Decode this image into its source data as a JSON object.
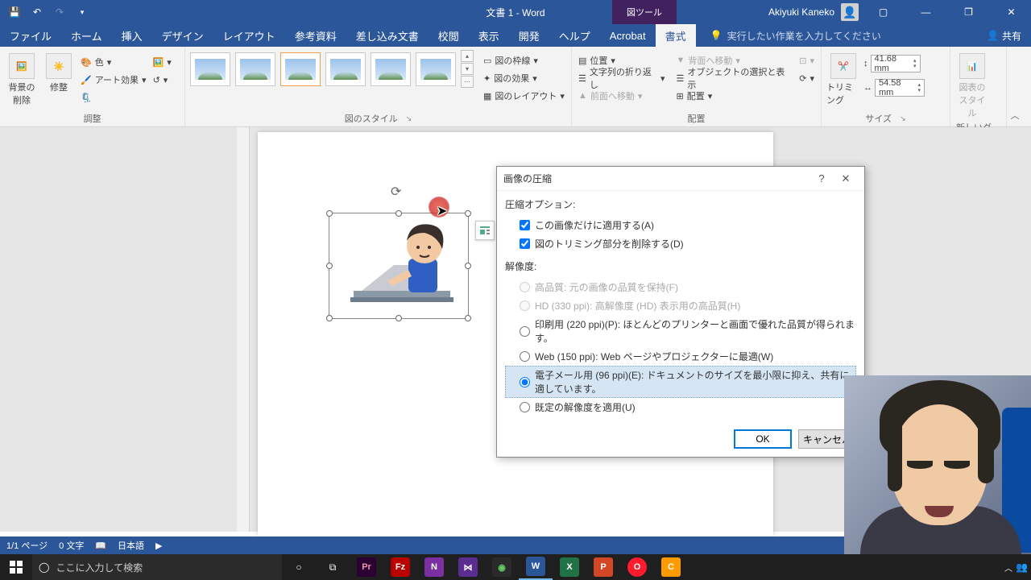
{
  "titlebar": {
    "doc_title": "文書 1 - Word",
    "context_tab": "図ツール",
    "user": "Akiyuki Kaneko"
  },
  "tabs": {
    "file": "ファイル",
    "home": "ホーム",
    "insert": "挿入",
    "design": "デザイン",
    "layout": "レイアウト",
    "references": "参考資料",
    "mailings": "差し込み文書",
    "review": "校閲",
    "view": "表示",
    "developer": "開発",
    "help": "ヘルプ",
    "acrobat": "Acrobat",
    "format": "書式",
    "tellme": "実行したい作業を入力してください",
    "share": "共有"
  },
  "ribbon": {
    "adjust": {
      "remove_bg": "背景の\n削除",
      "corrections": "修整",
      "color": "色",
      "effects": "アート効果",
      "label": "調整"
    },
    "styles": {
      "border": "図の枠線",
      "effects": "図の効果",
      "layout": "図のレイアウト",
      "label": "図のスタイル"
    },
    "arrange": {
      "position": "位置",
      "wrap": "文字列の折り返し",
      "forward": "前面へ移動",
      "backward": "背面へ移動",
      "selpane": "オブジェクトの選択と表示",
      "align": "配置",
      "label": "配置"
    },
    "size": {
      "crop": "トリミング",
      "height": "41.68 mm",
      "width": "54.58 mm",
      "label": "サイズ"
    },
    "newgrp": {
      "style": "図表の\nスタイル",
      "label": "新しいグ…"
    }
  },
  "dialog": {
    "title": "画像の圧縮",
    "sect1": "圧縮オプション:",
    "opt_apply": "この画像だけに適用する(A)",
    "opt_crop": "図のトリミング部分を削除する(D)",
    "sect2": "解像度:",
    "r_hq": "高品質: 元の画像の品質を保持(F)",
    "r_hd": "HD (330 ppi): 高解像度 (HD) 表示用の高品質(H)",
    "r_print": "印刷用 (220 ppi)(P): ほとんどのプリンターと画面で優れた品質が得られます。",
    "r_web": "Web (150 ppi): Web ページやプロジェクターに最適(W)",
    "r_email": "電子メール用 (96 ppi)(E): ドキュメントのサイズを最小限に抑え、共有に適しています。",
    "r_default": "既定の解像度を適用(U)",
    "ok": "OK",
    "cancel": "キャンセル"
  },
  "status": {
    "page": "1/1 ページ",
    "words": "0 文字",
    "lang": "日本語"
  },
  "taskbar": {
    "search_placeholder": "ここに入力して検索"
  }
}
